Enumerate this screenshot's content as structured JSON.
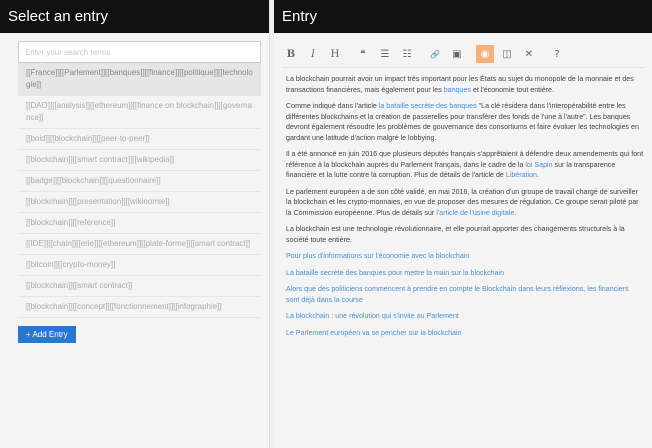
{
  "left": {
    "title": "Select an entry",
    "search_placeholder": "Enter your search terms",
    "entries": [
      "[[France]][[Parlement]][[banques]][[finance]][[politique]][[technologie]]",
      "[[DAO]][[analysis]][[ethereum]][[finance on blockchain]][[governance]]",
      "[[bold]][[blockchain]][[peer-to-peer]]",
      "[[blockchain]][[smart contract]][[wikipedia]]",
      "[[badge]][[blockchain]][[questionnaire]]",
      "[[blockchain]][[presentation]][[wikinomie]]",
      "[[blockchain]][[reference]]",
      "[[IDE]][[chain]][[erie]][[ethereum]][[plate-forme]][[smart contract]]",
      "[[bitcoin]][[crypto-money]]",
      "[[blockchain]][[smart contract]]",
      "[[blockchain]][[concept]][[fonctionnement]][[infographie]]"
    ],
    "add_label": "+ Add Entry"
  },
  "right": {
    "title": "Entry",
    "toolbar": [
      "B",
      "I",
      "H",
      "❝",
      "☰",
      "☷",
      "🔗",
      "▣",
      "◉",
      "◫",
      "✕",
      "?"
    ],
    "paragraphs": {
      "p1a": "La blockchain pourrait avoir un impact très important pour les États au sujet du monopole de la monnaie et des transactions financières, mais également pour les ",
      "p1link": "banques",
      "p1b": " et l'économie tout entière.",
      "p2a": "Comme indiqué dans l'article ",
      "p2link": "la bataille secrète des banques",
      "p2b": " \"La clé résidera dans l'interopérabilité entre les différentes blockchains et la création de passerelles pour transférer des fonds de l'une à l'autre\". Les banques devront également résoudre les problèmes de gouvernance des consortiums et faire évoluer les technologies en gardant une latitude d'action malgré le lobbying.",
      "p3a": "Il a été annoncé en juin 2016 que plusieurs députés français s'apprêtaient à défendre deux amendements qui font référence à la blockchain auprès du Parlement français, dans le cadre de la ",
      "p3link": "loi Sapin",
      "p3b": " sur la transparence financière et la lutte contre la corruption. Plus de détails de l'article de ",
      "p3link2": "Libération",
      "p3c": ".",
      "p4a": "Le parlement européen a de son côté validé, en mai 2016, la création d'un groupe de travail chargé de surveiller la blockchain et les crypto-monnaies, en vue de proposer des mesures de régulation. Ce groupe serait piloté par la Commission européenne. Plus de détails sur ",
      "p4link": "l'article de l'usine digitale",
      "p4b": ".",
      "p5": "La blockchain est une technologie révolutionnaire, et elle pourrait apporter des changements structurels à la société toute entière."
    },
    "links": [
      "Pour plus d'informations sur l'économie avec la blockchain",
      "La bataille secrète des banques pour mettre la main sur la blockchain",
      "Alors que des politiciens commencent à prendre en compte le Blockchain dans leurs réflexions, les financiers sont déjà dans la course",
      "La blockchain : une révolution qui s'invite au Parlement",
      "Le Parlement européen va se pencher sur la blockchain"
    ]
  }
}
